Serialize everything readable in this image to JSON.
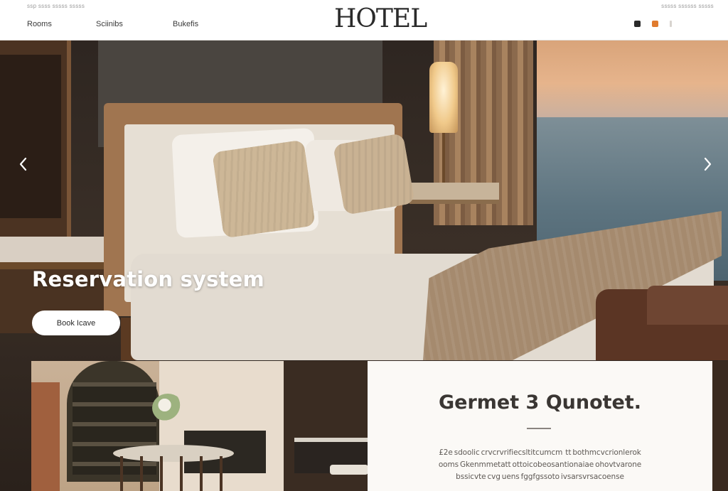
{
  "header": {
    "top_note_left": "ssp ssss sssss sssss",
    "top_note_right": "sssss ssssss sssss",
    "logo": "HOTEL",
    "nav": [
      "Rooms",
      "Sciinibs",
      "Bukefis"
    ],
    "icons": [
      "menu-square-icon",
      "cart-icon",
      "more-icon"
    ]
  },
  "hero": {
    "title": "Reservation system",
    "cta_label": "Book Icave",
    "prev_label": "‹",
    "next_label": "›"
  },
  "info_card": {
    "title": "Germet 3 Qunotet.",
    "lines": [
      "£2e sdoolic crvcrvrifiecsltitcumcm  tt bothmcvcrionlerok",
      "ooms Gkenmmetatt ottoicobeosantionaiae ohovtvarone",
      "bssicvte cvg uens fggfgssoto ivsarsvrsacoense"
    ]
  },
  "colors": {
    "header_bg": "#ffffff",
    "accent": "#e07b2e",
    "text_dark": "#2b2b2b",
    "card_bg": "#fbf9f6"
  }
}
